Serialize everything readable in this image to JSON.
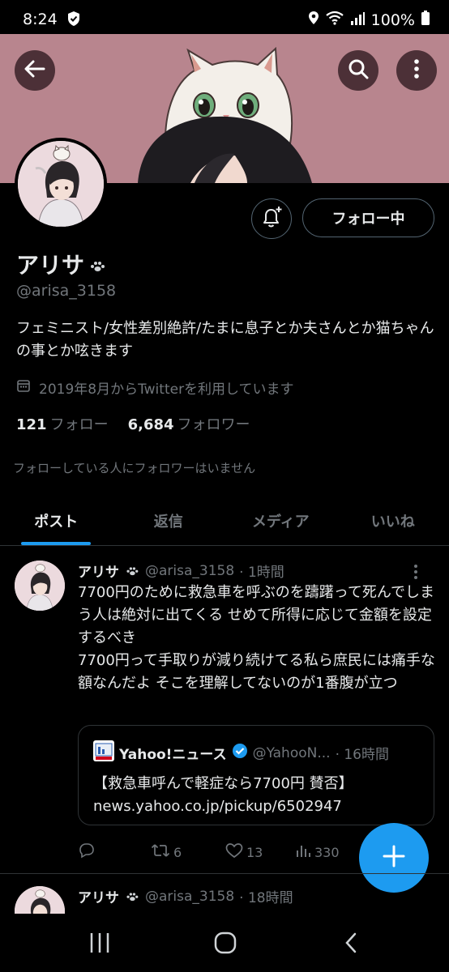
{
  "status_bar": {
    "time": "8:24",
    "battery": "100%"
  },
  "profile": {
    "name": "アリサ",
    "handle": "@arisa_3158",
    "bio": "フェミニスト/女性差別絶許/たまに息子とか夫さんとか猫ちゃんの事とか呟きます",
    "joined": "2019年8月からTwitterを利用しています",
    "following_count": "121",
    "following_label": "フォロー",
    "followers_count": "6,684",
    "followers_label": "フォロワー",
    "known_followers": "フォローしている人にフォロワーはいません",
    "follow_button": "フォロー中"
  },
  "tabs": [
    {
      "label": "ポスト",
      "active": true
    },
    {
      "label": "返信",
      "active": false
    },
    {
      "label": "メディア",
      "active": false
    },
    {
      "label": "いいね",
      "active": false
    }
  ],
  "tweet": {
    "name": "アリサ",
    "handle": "@arisa_3158",
    "time": "· 1時間",
    "text": "7700円のために救急車を呼ぶのを躊躇って死んでしまう人は絶対に出てくる せめて所得に応じて金額を設定するべき\n7700円って手取りが減り続けてる私ら庶民には痛手な額なんだよ そこを理解してないのが1番腹が立つ",
    "quote": {
      "name": "Yahoo!ニュース",
      "handle": "@YahooN...",
      "time": "· 16時間",
      "line1": "【救急車呼んで軽症なら7700円 賛否】",
      "line2": "news.yahoo.co.jp/pickup/6502947"
    },
    "retweets": "6",
    "likes": "13",
    "views": "330"
  },
  "tweet2": {
    "name": "アリサ",
    "handle": "@arisa_3158",
    "time": "· 18時間"
  },
  "colors": {
    "accent": "#1d9bf0",
    "banner": "#b8858e",
    "muted": "#71767b"
  },
  "icons": [
    "back-arrow-icon",
    "search-icon",
    "more-vertical-icon",
    "bell-plus-icon",
    "calendar-icon",
    "paw-icon",
    "verified-badge-icon",
    "reply-icon",
    "retweet-icon",
    "like-icon",
    "views-icon",
    "compose-plus-icon"
  ]
}
